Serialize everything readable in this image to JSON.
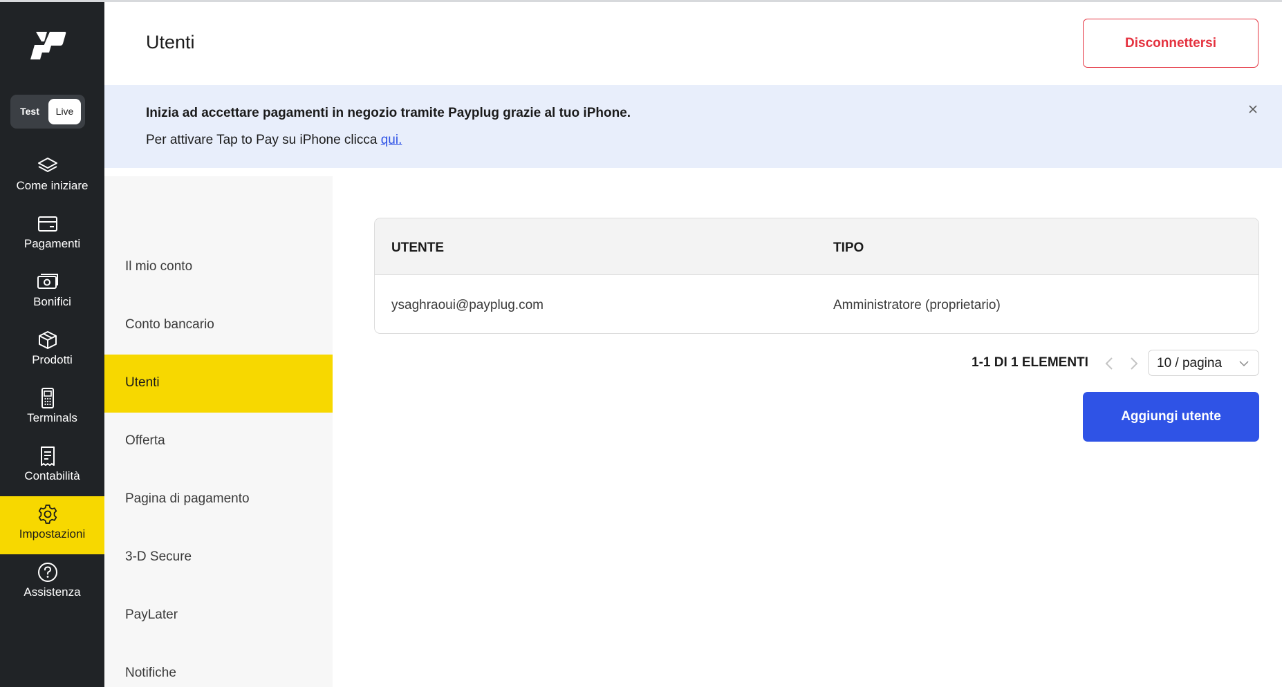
{
  "header": {
    "title": "Utenti",
    "logout_label": "Disconnettersi"
  },
  "env_toggle": {
    "test_label": "Test",
    "live_label": "Live",
    "selected": "Live"
  },
  "nav": {
    "items": [
      {
        "label": "Come iniziare",
        "icon": "layers-icon"
      },
      {
        "label": "Pagamenti",
        "icon": "card-icon"
      },
      {
        "label": "Bonifici",
        "icon": "cash-icon"
      },
      {
        "label": "Prodotti",
        "icon": "box-icon"
      },
      {
        "label": "Terminals",
        "icon": "terminal-icon"
      },
      {
        "label": "Contabilità",
        "icon": "receipt-icon"
      },
      {
        "label": "Impostazioni",
        "icon": "gear-icon"
      },
      {
        "label": "Assistenza",
        "icon": "help-icon"
      }
    ],
    "active": "Impostazioni",
    "active_color": "#f7d800"
  },
  "banner": {
    "line1": "Inizia ad accettare pagamenti in negozio tramite Payplug grazie al tuo iPhone.",
    "line2_prefix": "Per attivare Tap to Pay su iPhone clicca ",
    "link_text": "qui."
  },
  "subnav": {
    "items": [
      "Il mio conto",
      "Conto bancario",
      "Utenti",
      "Offerta",
      "Pagina di pagamento",
      "3-D Secure",
      "PayLater",
      "Notifiche"
    ],
    "active": "Utenti"
  },
  "table": {
    "columns": [
      "UTENTE",
      "TIPO"
    ],
    "rows": [
      [
        "ysaghraoui@payplug.com",
        "Amministratore (proprietario)"
      ]
    ]
  },
  "pagination": {
    "count_label": "1-1 DI 1 ELEMENTI",
    "page_size": "10 / pagina"
  },
  "actions": {
    "add_user_label": "Aggiungi utente"
  },
  "colors": {
    "rail_bg": "#202326",
    "accent_yellow": "#f7d800",
    "primary_blue": "#2f53e6",
    "danger_red": "#e4313e",
    "banner_bg": "#e8eefb"
  }
}
